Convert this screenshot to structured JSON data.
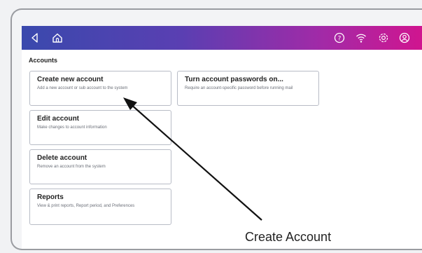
{
  "screen": {
    "section_title": "Accounts",
    "tiles": [
      {
        "title": "Create new account",
        "desc": "Add a new account or sub account to the system"
      },
      {
        "title": "Turn account passwords on...",
        "desc": "Require an account-specific password before running mail"
      },
      {
        "title": "Edit account",
        "desc": "Make changes to account information"
      },
      {
        "title": "Delete account",
        "desc": "Remove an account from the system"
      },
      {
        "title": "Reports",
        "desc": "View & print reports, Report period, and Preferences"
      }
    ]
  },
  "topbar": {
    "icons": [
      "back-icon",
      "home-icon",
      "help-icon",
      "wifi-icon",
      "settings-icon",
      "account-icon"
    ]
  },
  "annotation": {
    "caption": "Create Account"
  },
  "colors": {
    "gradient_start": "#3a49ad",
    "gradient_end": "#d0158f"
  }
}
